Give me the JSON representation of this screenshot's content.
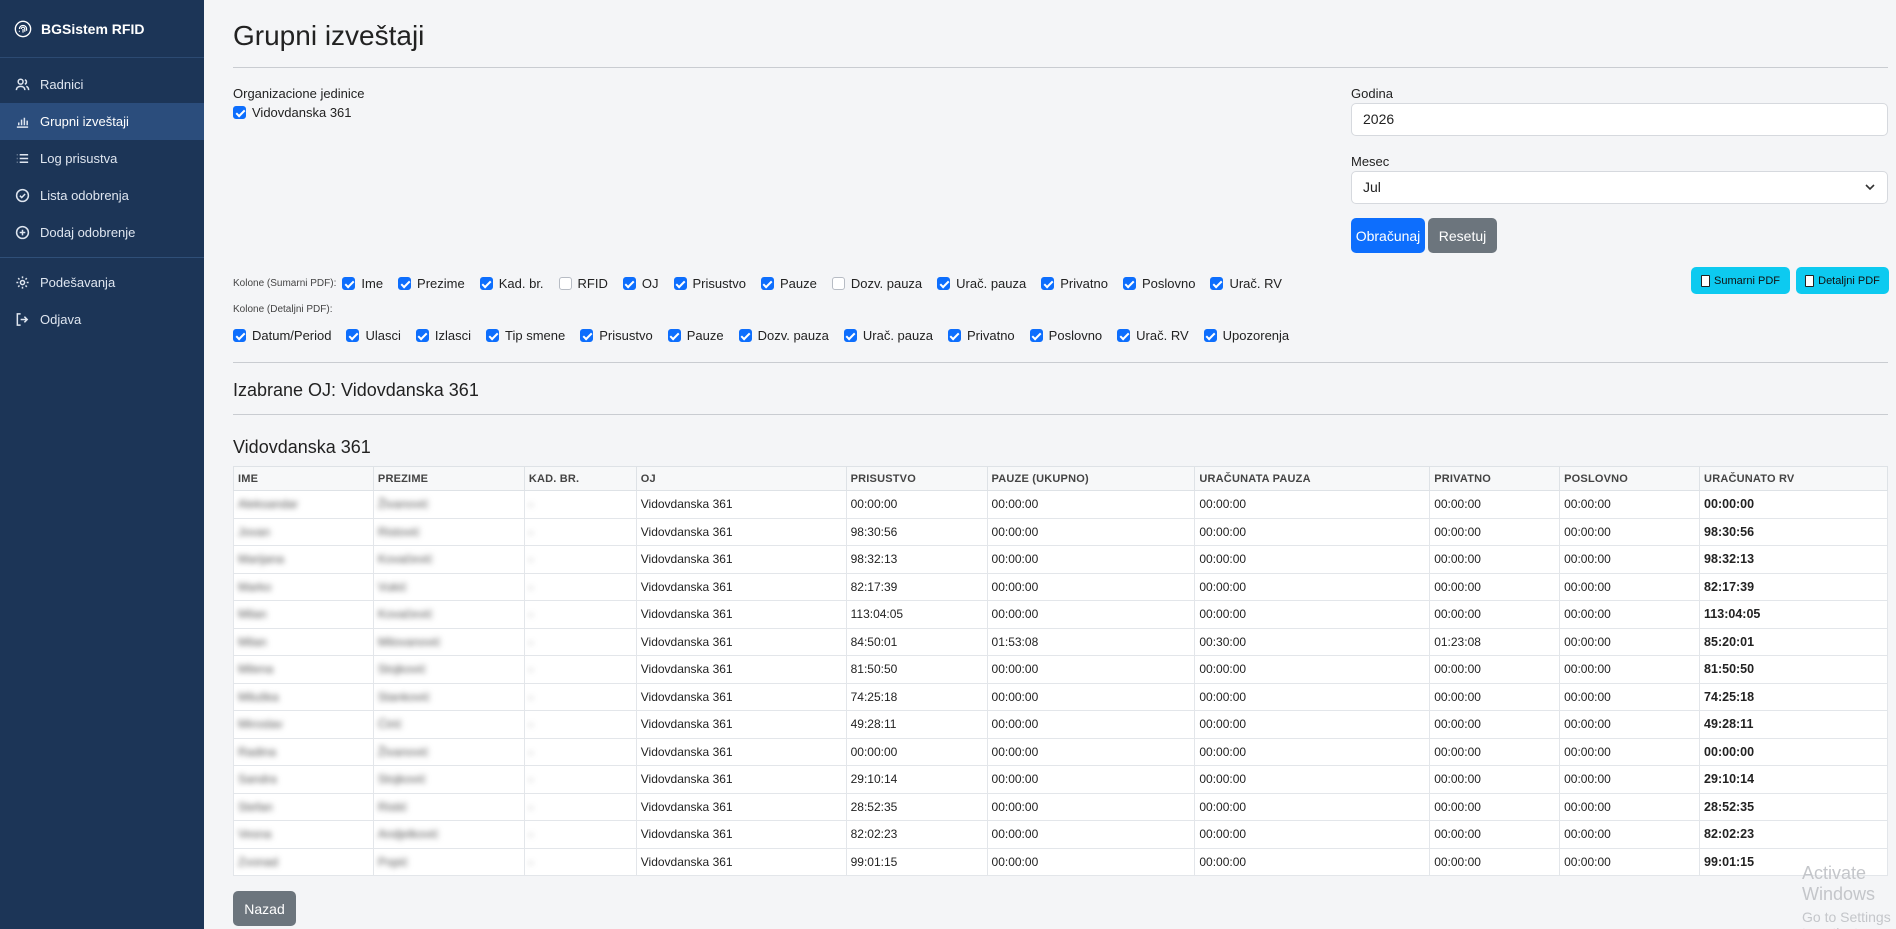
{
  "brand": {
    "name": "BGSistem RFID"
  },
  "sidebar": {
    "items": [
      {
        "label": "Radnici",
        "icon": "users-icon"
      },
      {
        "label": "Grupni izveštaji",
        "icon": "bar-chart-icon",
        "active": true
      },
      {
        "label": "Log prisustva",
        "icon": "list-icon"
      },
      {
        "label": "Lista odobrenja",
        "icon": "check-circle-icon"
      },
      {
        "label": "Dodaj odobrenje",
        "icon": "plus-circle-icon"
      }
    ],
    "bottom_items": [
      {
        "label": "Podešavanja",
        "icon": "gear-icon"
      },
      {
        "label": "Odjava",
        "icon": "logout-icon"
      }
    ]
  },
  "page": {
    "title": "Grupni izveštaji"
  },
  "filters": {
    "org_label": "Organizacione jedinice",
    "org_unit": "Vidovdanska 361",
    "year_label": "Godina",
    "year_value": "2026",
    "month_label": "Mesec",
    "month_value": "Jul",
    "calc_button": "Obračunaj",
    "reset_button": "Resetuj"
  },
  "pdf": {
    "summary_button": "Sumarni PDF",
    "detail_button": "Detaljni PDF"
  },
  "summary_cols": {
    "title": "Kolone (Sumarni PDF):",
    "options": [
      {
        "label": "Ime",
        "checked": true
      },
      {
        "label": "Prezime",
        "checked": true
      },
      {
        "label": "Kad. br.",
        "checked": true
      },
      {
        "label": "RFID",
        "checked": false
      },
      {
        "label": "OJ",
        "checked": true
      },
      {
        "label": "Prisustvo",
        "checked": true
      },
      {
        "label": "Pauze",
        "checked": true
      },
      {
        "label": "Dozv. pauza",
        "checked": false
      },
      {
        "label": "Urač. pauza",
        "checked": true
      },
      {
        "label": "Privatno",
        "checked": true
      },
      {
        "label": "Poslovno",
        "checked": true
      },
      {
        "label": "Urač. RV",
        "checked": true
      }
    ]
  },
  "detail_cols": {
    "title": "Kolone (Detaljni PDF):",
    "options": [
      {
        "label": "Datum/Period",
        "checked": true
      },
      {
        "label": "Ulasci",
        "checked": true
      },
      {
        "label": "Izlasci",
        "checked": true
      },
      {
        "label": "Tip smene",
        "checked": true
      },
      {
        "label": "Prisustvo",
        "checked": true
      },
      {
        "label": "Pauze",
        "checked": true
      },
      {
        "label": "Dozv. pauza",
        "checked": true
      },
      {
        "label": "Urač. pauza",
        "checked": true
      },
      {
        "label": "Privatno",
        "checked": true
      },
      {
        "label": "Poslovno",
        "checked": true
      },
      {
        "label": "Urač. RV",
        "checked": true
      },
      {
        "label": "Upozorenja",
        "checked": true
      }
    ]
  },
  "selected": {
    "heading": "Izabrane OJ: Vidovdanska 361"
  },
  "group": {
    "heading": "Vidovdanska 361"
  },
  "table": {
    "headers": [
      "IME",
      "PREZIME",
      "KAD. BR.",
      "OJ",
      "PRISUSTVO",
      "PAUZE (UKUPNO)",
      "URAČUNATA PAUZA",
      "PRIVATNO",
      "POSLOVNO",
      "URAČUNATO RV"
    ],
    "rows": [
      [
        "Aleksandar",
        "Živanović",
        "-",
        "Vidovdanska 361",
        "00:00:00",
        "00:00:00",
        "00:00:00",
        "00:00:00",
        "00:00:00",
        "00:00:00"
      ],
      [
        "Jovan",
        "Ristović",
        "-",
        "Vidovdanska 361",
        "98:30:56",
        "00:00:00",
        "00:00:00",
        "00:00:00",
        "00:00:00",
        "98:30:56"
      ],
      [
        "Marijana",
        "Kovačević",
        "-",
        "Vidovdanska 361",
        "98:32:13",
        "00:00:00",
        "00:00:00",
        "00:00:00",
        "00:00:00",
        "98:32:13"
      ],
      [
        "Marko",
        "Vukić",
        "-",
        "Vidovdanska 361",
        "82:17:39",
        "00:00:00",
        "00:00:00",
        "00:00:00",
        "00:00:00",
        "82:17:39"
      ],
      [
        "Milan",
        "Kovačević",
        "-",
        "Vidovdanska 361",
        "113:04:05",
        "00:00:00",
        "00:00:00",
        "00:00:00",
        "00:00:00",
        "113:04:05"
      ],
      [
        "Milan",
        "Milovanović",
        "-",
        "Vidovdanska 361",
        "84:50:01",
        "01:53:08",
        "00:30:00",
        "01:23:08",
        "00:00:00",
        "85:20:01"
      ],
      [
        "Milena",
        "Stojković",
        "-",
        "Vidovdanska 361",
        "81:50:50",
        "00:00:00",
        "00:00:00",
        "00:00:00",
        "00:00:00",
        "81:50:50"
      ],
      [
        "Miluška",
        "Stanković",
        "-",
        "Vidovdanska 361",
        "74:25:18",
        "00:00:00",
        "00:00:00",
        "00:00:00",
        "00:00:00",
        "74:25:18"
      ],
      [
        "Miroslav",
        "Ćirić",
        "-",
        "Vidovdanska 361",
        "49:28:11",
        "00:00:00",
        "00:00:00",
        "00:00:00",
        "00:00:00",
        "49:28:11"
      ],
      [
        "Radina",
        "Živanović",
        "-",
        "Vidovdanska 361",
        "00:00:00",
        "00:00:00",
        "00:00:00",
        "00:00:00",
        "00:00:00",
        "00:00:00"
      ],
      [
        "Sandra",
        "Stojković",
        "-",
        "Vidovdanska 361",
        "29:10:14",
        "00:00:00",
        "00:00:00",
        "00:00:00",
        "00:00:00",
        "29:10:14"
      ],
      [
        "Stefan",
        "Ristić",
        "-",
        "Vidovdanska 361",
        "28:52:35",
        "00:00:00",
        "00:00:00",
        "00:00:00",
        "00:00:00",
        "28:52:35"
      ],
      [
        "Vesna",
        "Andjelković",
        "-",
        "Vidovdanska 361",
        "82:02:23",
        "00:00:00",
        "00:00:00",
        "00:00:00",
        "00:00:00",
        "82:02:23"
      ],
      [
        "Zvonad",
        "Popić",
        "-",
        "Vidovdanska 361",
        "99:01:15",
        "00:00:00",
        "00:00:00",
        "00:00:00",
        "00:00:00",
        "99:01:15"
      ]
    ]
  },
  "back_button": "Nazad",
  "watermark": {
    "line1": "Activate Windows",
    "line2": "Go to Settings to activate Windows."
  },
  "colors": {
    "sidebar": "#1c3557",
    "sidebar_active": "#2b4d7c",
    "primary": "#0d6efd",
    "secondary": "#6c757d",
    "cyan": "#0dcaf0"
  }
}
